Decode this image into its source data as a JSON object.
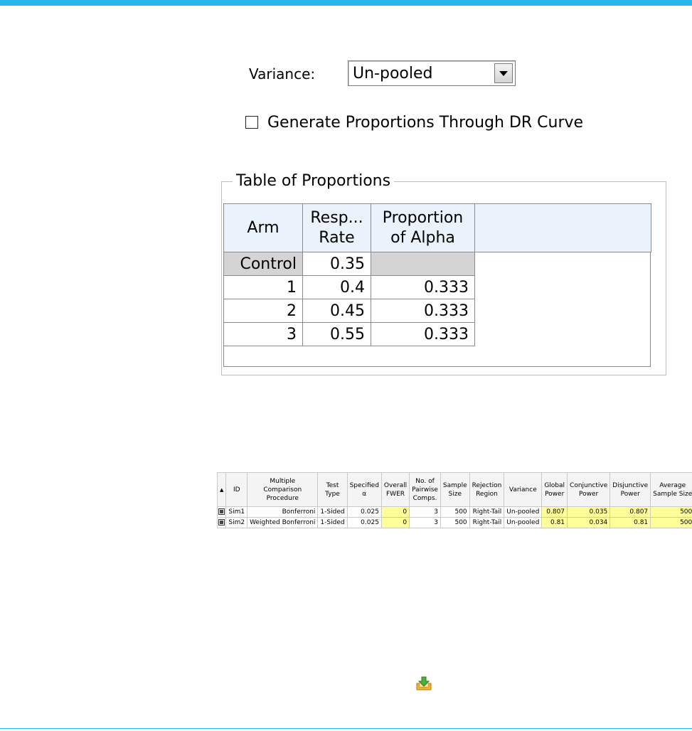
{
  "variance": {
    "label": "Variance:",
    "selected": "Un-pooled"
  },
  "dr_curve": {
    "label": "Generate Proportions Through DR Curve",
    "checked": false
  },
  "proportions_table": {
    "title": "Table of Proportions",
    "headers": {
      "arm": "Arm",
      "resp_line1": "Resp...",
      "resp_line2": "Rate",
      "alpha_line1": "Proportion",
      "alpha_line2": "of Alpha"
    },
    "rows": [
      {
        "arm": "Control",
        "rate": "0.35",
        "alpha": ""
      },
      {
        "arm": "1",
        "rate": "0.4",
        "alpha": "0.333"
      },
      {
        "arm": "2",
        "rate": "0.45",
        "alpha": "0.333"
      },
      {
        "arm": "3",
        "rate": "0.55",
        "alpha": "0.333"
      }
    ]
  },
  "sim_table": {
    "headers": {
      "sort": "▲",
      "id": "ID",
      "mcp_1": "Multiple",
      "mcp_2": "Comparison",
      "mcp_3": "Procedure",
      "test_1": "Test",
      "test_2": "Type",
      "alpha_1": "Specified",
      "alpha_2": "α",
      "fwer_1": "Overall",
      "fwer_2": "FWER",
      "pair_1": "No. of",
      "pair_2": "Pairwise",
      "pair_3": "Comps.",
      "ss_1": "Sample",
      "ss_2": "Size",
      "rr_1": "Rejection",
      "rr_2": "Region",
      "variance": "Variance",
      "gp_1": "Global",
      "gp_2": "Power",
      "cp_1": "Conjunctive",
      "cp_2": "Power",
      "dp_1": "Disjunctive",
      "dp_2": "Power",
      "as_1": "Average",
      "as_2": "Sample Size"
    },
    "rows": [
      {
        "id": "Sim1",
        "procedure": "Bonferroni",
        "test_type": "1-Sided",
        "alpha": "0.025",
        "fwer": "0",
        "comps": "3",
        "sample_size": "500",
        "region": "Right-Tail",
        "variance": "Un-pooled",
        "global_power": "0.807",
        "conj_power": "0.035",
        "disj_power": "0.807",
        "avg_ss": "500"
      },
      {
        "id": "Sim2",
        "procedure": "Weighted Bonferroni",
        "test_type": "1-Sided",
        "alpha": "0.025",
        "fwer": "0",
        "comps": "3",
        "sample_size": "500",
        "region": "Right-Tail",
        "variance": "Un-pooled",
        "global_power": "0.81",
        "conj_power": "0.034",
        "disj_power": "0.81",
        "avg_ss": "500"
      }
    ]
  },
  "colors": {
    "accent_bar": "#29b6e8",
    "header_bg": "#eaf3fc",
    "highlight": "#ffff99"
  },
  "icons": {
    "dropdown": "chevron-down-icon",
    "export": "export-icon",
    "sim_row": "simulation-icon"
  }
}
